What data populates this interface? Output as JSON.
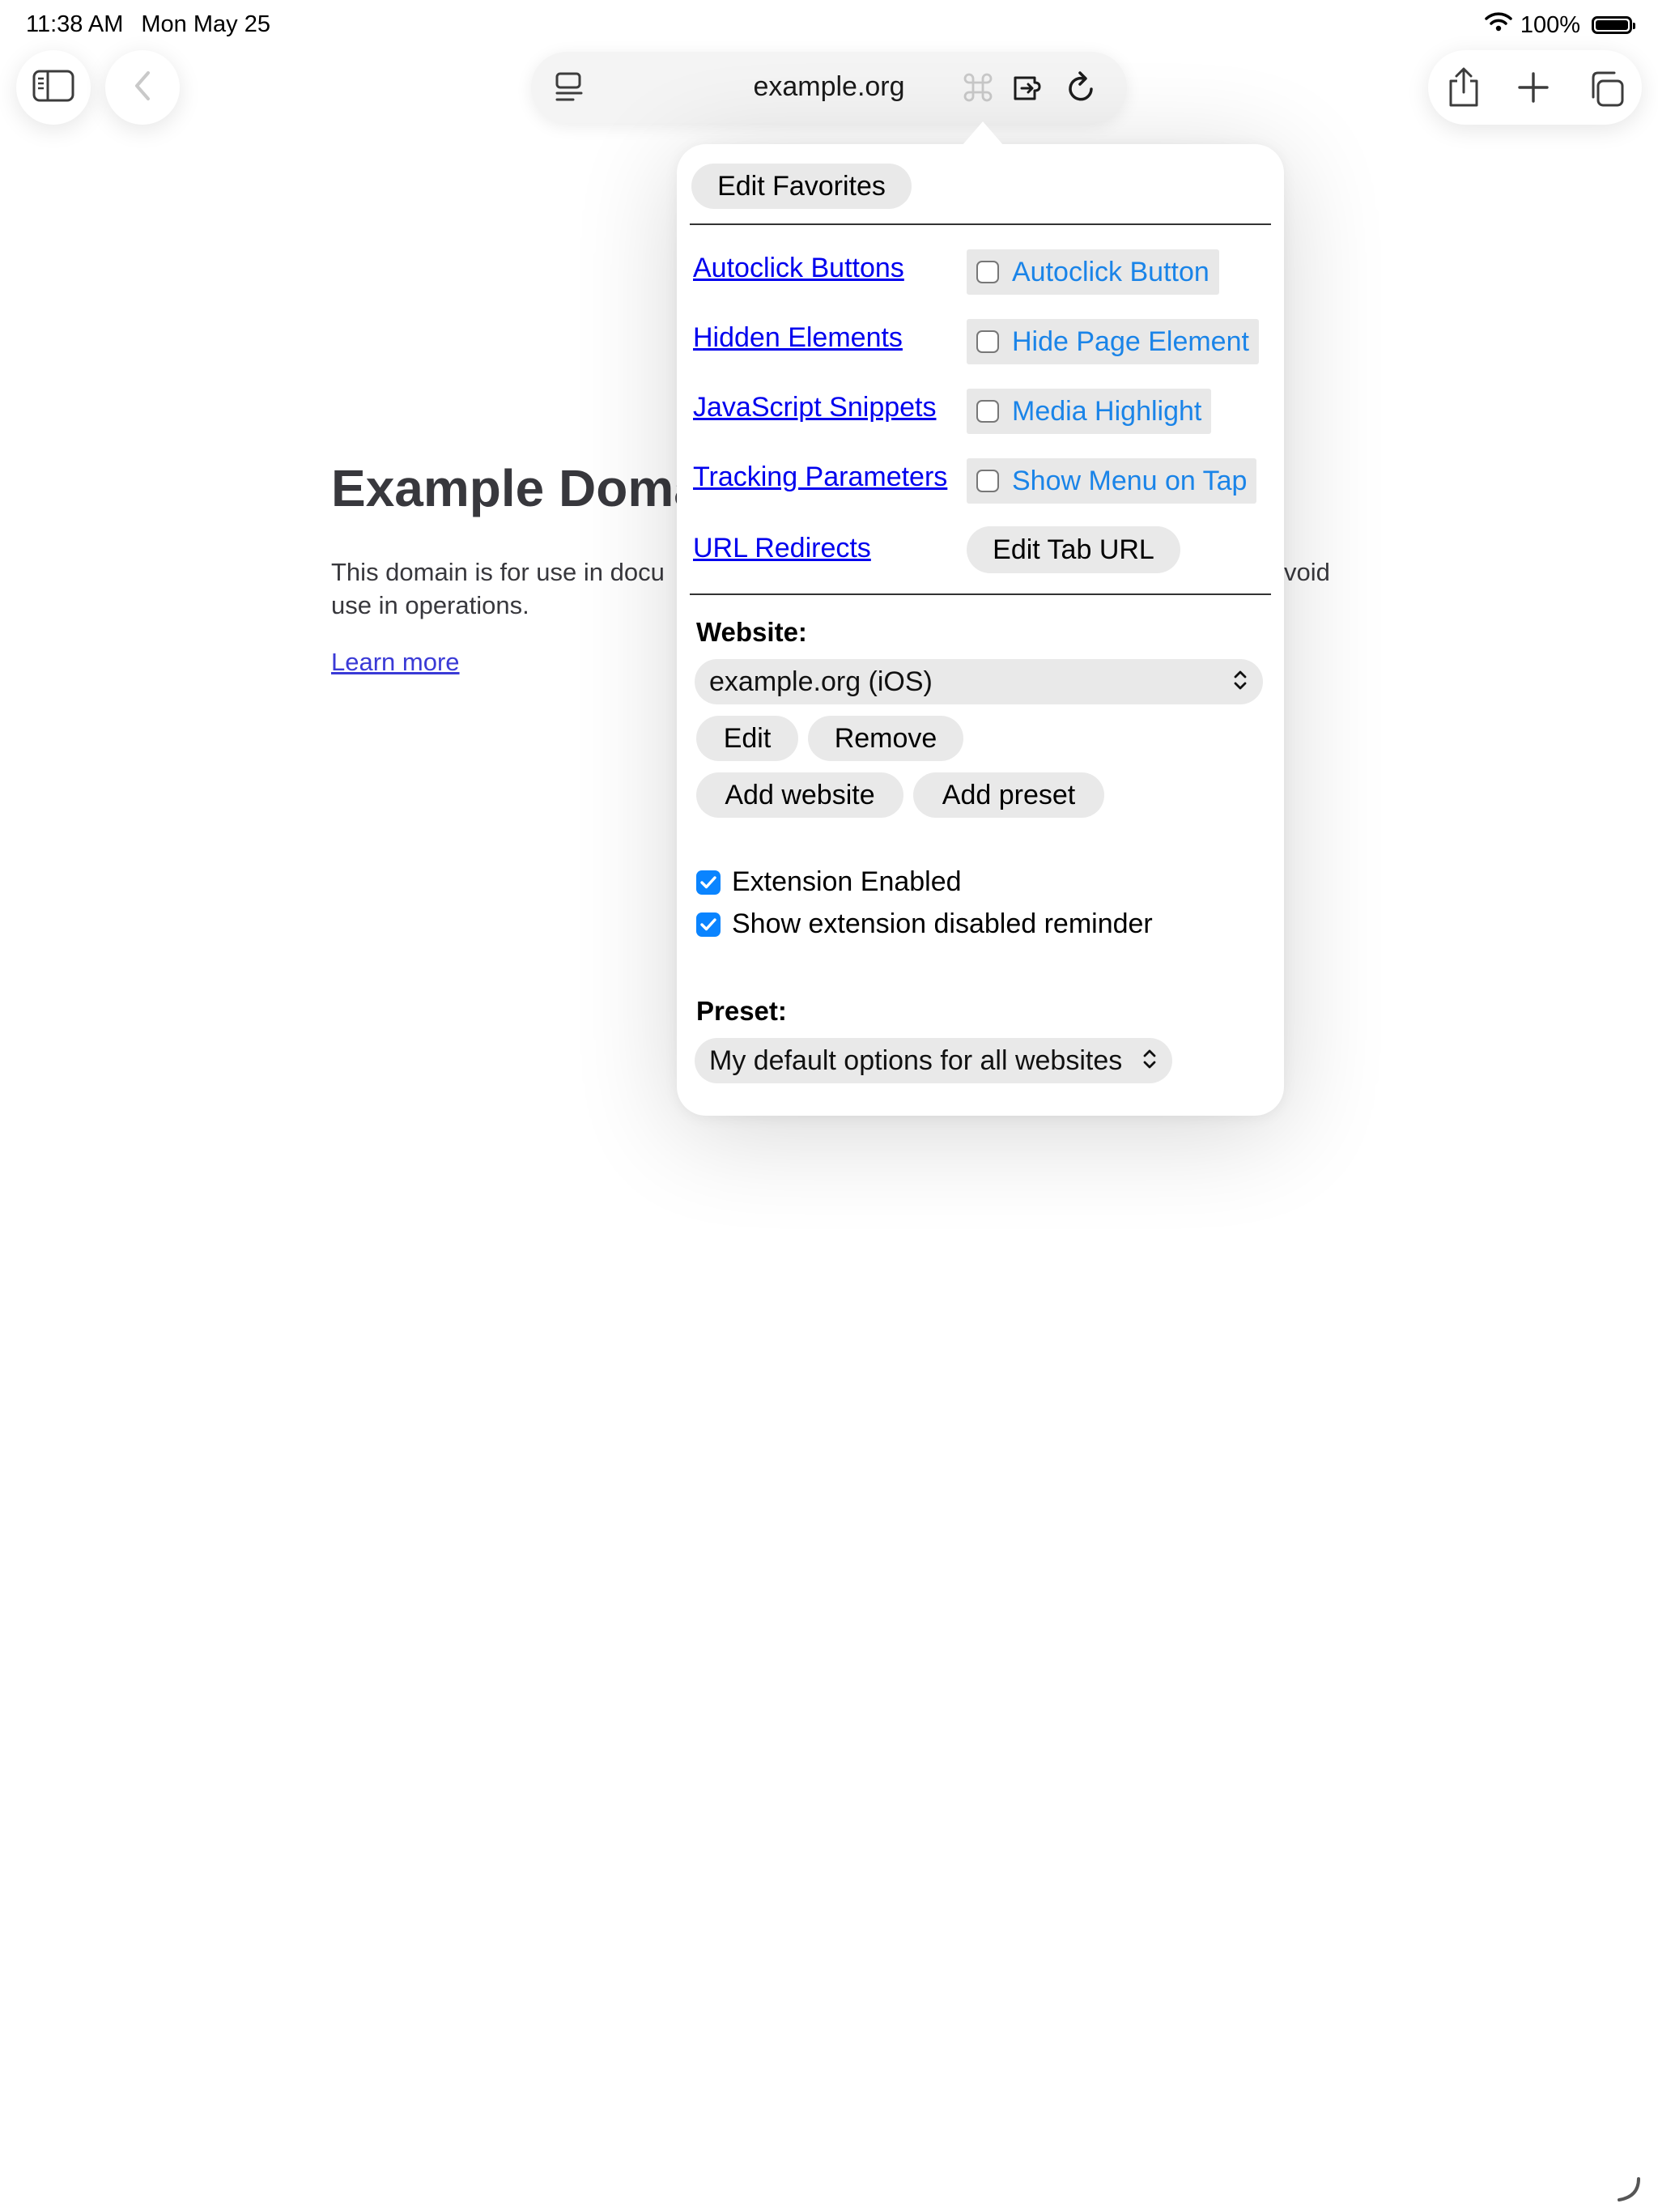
{
  "status_bar": {
    "time": "11:38 AM",
    "date": "Mon May 25",
    "battery_pct": "100%",
    "icons": [
      "wifi-icon",
      "battery-icon"
    ]
  },
  "toolbar": {
    "url": "example.org",
    "left_icons": [
      "sidebar-icon",
      "back-icon"
    ],
    "url_icons": [
      "page-menu-icon",
      "command-icon",
      "extension-icon",
      "reload-icon"
    ],
    "right_icons": [
      "share-icon",
      "new-tab-icon",
      "tabs-icon"
    ]
  },
  "page": {
    "title": "Example Doma",
    "paragraph_left": "This domain is for use in docu",
    "paragraph_right": "void",
    "paragraph_line2": "use in operations.",
    "link": "Learn more"
  },
  "popover": {
    "edit_favorites": "Edit Favorites",
    "features": [
      {
        "link": "Autoclick Buttons",
        "option": "Autoclick Button",
        "checked": false
      },
      {
        "link": "Hidden Elements",
        "option": "Hide Page Element",
        "checked": false
      },
      {
        "link": "JavaScript Snippets",
        "option": "Media Highlight",
        "checked": false
      },
      {
        "link": "Tracking Parameters",
        "option": "Show Menu on Tap",
        "checked": false
      },
      {
        "link": "URL Redirects",
        "option": "Edit Tab URL"
      }
    ],
    "website": {
      "label": "Website:",
      "selected": "example.org (iOS)",
      "edit": "Edit",
      "remove": "Remove",
      "add_website": "Add website",
      "add_preset": "Add preset"
    },
    "toggles": [
      {
        "label": "Extension Enabled",
        "checked": true
      },
      {
        "label": "Show extension disabled reminder",
        "checked": true
      }
    ],
    "preset": {
      "label": "Preset:",
      "selected": "My default options for all websites"
    }
  },
  "colors": {
    "accent": "#0a84ff",
    "link": "#0000ee",
    "chip_text": "#1a84e8",
    "button_bg": "#e9e9e9"
  }
}
